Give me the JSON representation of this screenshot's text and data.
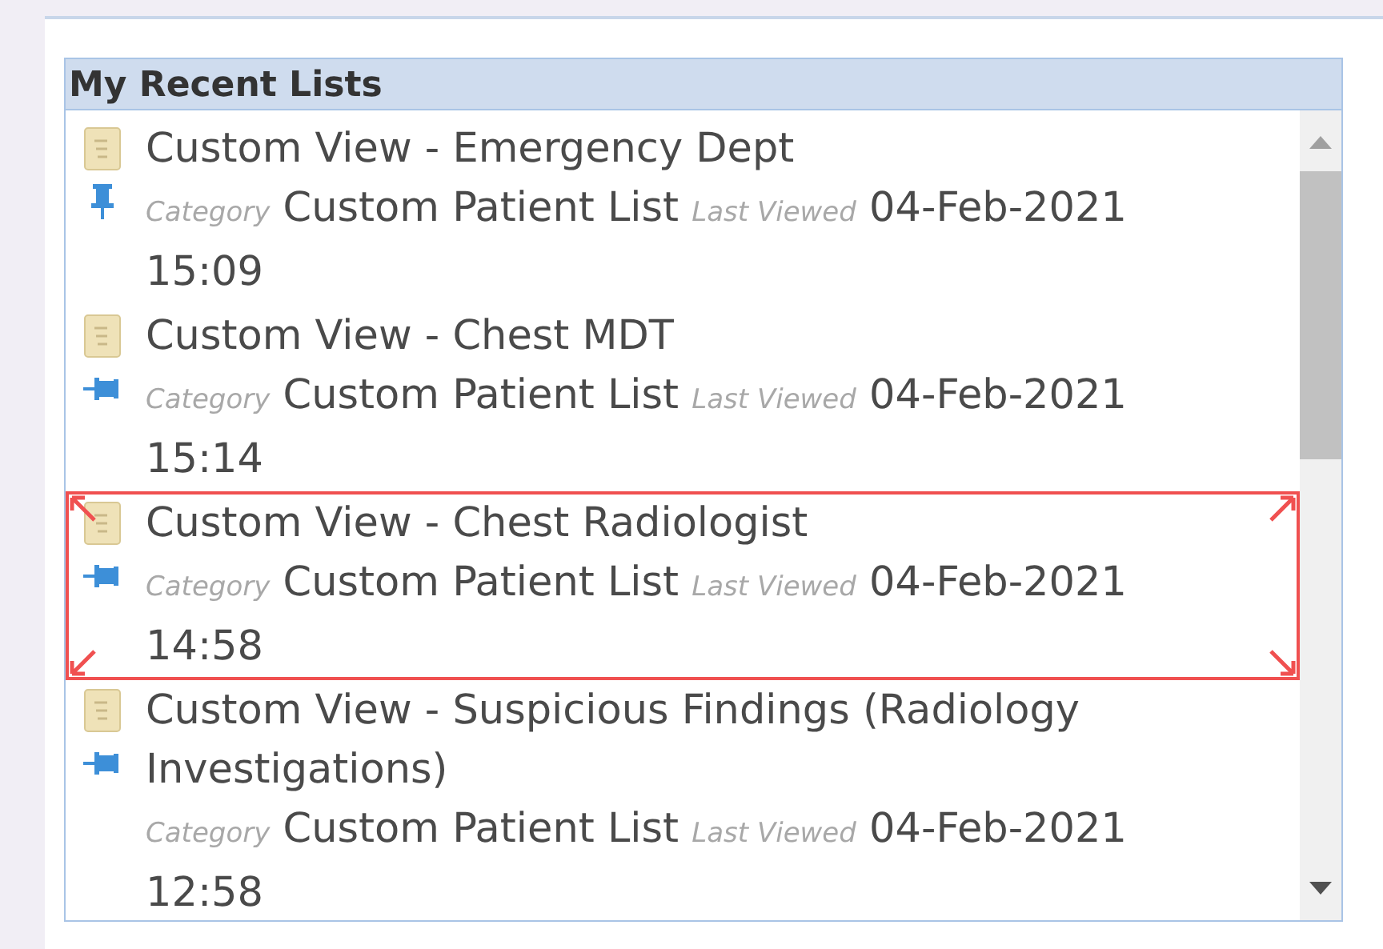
{
  "panel": {
    "title": "My Recent Lists"
  },
  "lists": [
    {
      "title": "Custom View - Emergency Dept",
      "pinned": true,
      "highlighted": false,
      "category_label": "Category",
      "category": "Custom Patient List",
      "viewed_label": "Last Viewed",
      "date": "04-Feb-2021",
      "time": "15:09"
    },
    {
      "title": "Custom View - Chest MDT",
      "pinned": false,
      "highlighted": false,
      "category_label": "Category",
      "category": "Custom Patient List",
      "viewed_label": "Last Viewed",
      "date": "04-Feb-2021",
      "time": "15:14"
    },
    {
      "title": "Custom View - Chest Radiologist",
      "pinned": false,
      "highlighted": true,
      "category_label": "Category",
      "category": "Custom Patient List",
      "viewed_label": "Last Viewed",
      "date": "04-Feb-2021",
      "time": "14:58"
    },
    {
      "title": "Custom View - Suspicious Findings (Radiology Investigations)",
      "pinned": false,
      "highlighted": false,
      "category_label": "Category",
      "category": "Custom Patient List",
      "viewed_label": "Last Viewed",
      "date": "04-Feb-2021",
      "time": "12:58"
    }
  ]
}
